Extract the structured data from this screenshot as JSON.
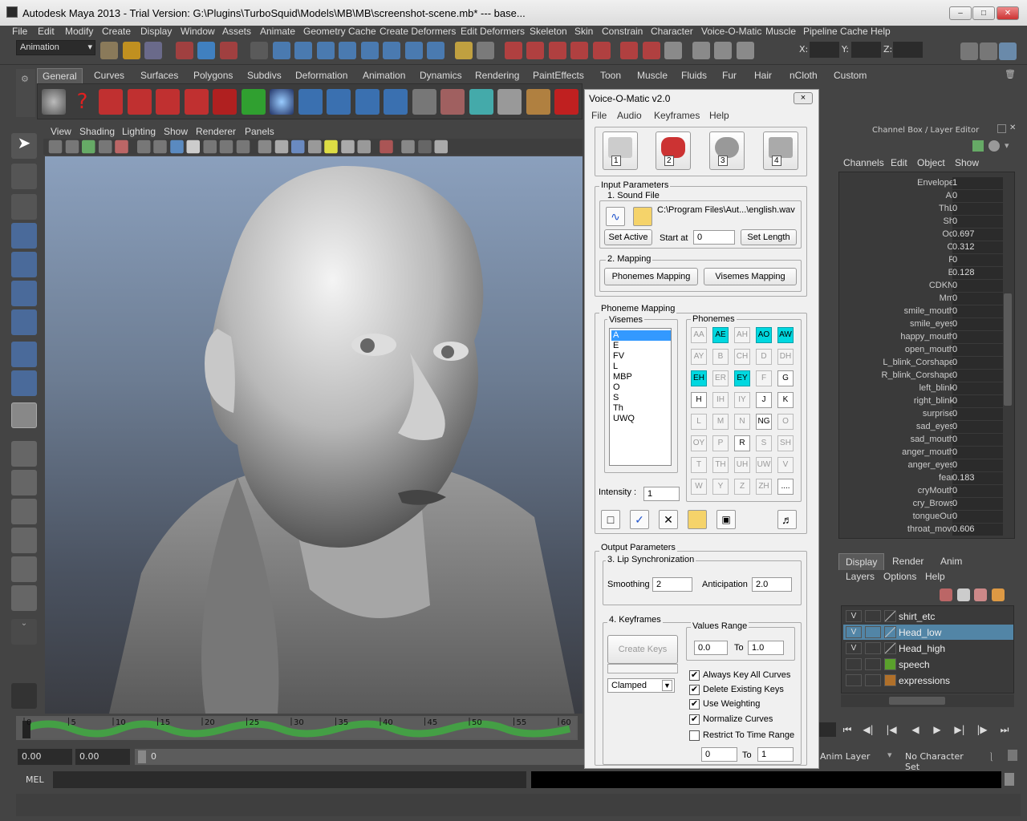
{
  "window": {
    "title": "Autodesk Maya 2013 - Trial Version: G:\\Plugins\\TurboSquid\\Models\\MB\\MB\\screenshot-scene.mb*   ---   base..."
  },
  "menubar": [
    "File",
    "Edit",
    "Modify",
    "Create",
    "Display",
    "Window",
    "Assets",
    "Animate",
    "Geometry Cache",
    "Create Deformers",
    "Edit Deformers",
    "Skeleton",
    "Skin",
    "Constrain",
    "Character",
    "Voice-O-Matic",
    "Muscle",
    "Pipeline Cache",
    "Help"
  ],
  "statusline": {
    "mode": "Animation",
    "x_label": "X:",
    "y_label": "Y:",
    "z_label": "Z:"
  },
  "shelf_tabs": [
    "General",
    "Curves",
    "Surfaces",
    "Polygons",
    "Subdivs",
    "Deformation",
    "Animation",
    "Dynamics",
    "Rendering",
    "PaintEffects",
    "Toon",
    "Muscle",
    "Fluids",
    "Fur",
    "Hair",
    "nCloth",
    "Custom"
  ],
  "viewport_menu": [
    "View",
    "Shading",
    "Lighting",
    "Show",
    "Renderer",
    "Panels"
  ],
  "channel_box": {
    "header": "Channel Box / Layer Editor",
    "menu": [
      "Channels",
      "Edit",
      "Object",
      "Show"
    ],
    "rows": [
      {
        "name": "Envelope",
        "value": "1"
      },
      {
        "name": "AI",
        "value": "0"
      },
      {
        "name": "ThL",
        "value": "0"
      },
      {
        "name": "Sh",
        "value": "0"
      },
      {
        "name": "Oo",
        "value": "0.697"
      },
      {
        "name": "O",
        "value": "0.312"
      },
      {
        "name": "F",
        "value": "0"
      },
      {
        "name": "E",
        "value": "0.128"
      },
      {
        "name": "CDKN",
        "value": "0"
      },
      {
        "name": "Mm",
        "value": "0"
      },
      {
        "name": "smile_mouth",
        "value": "0"
      },
      {
        "name": "smile_eyes",
        "value": "0"
      },
      {
        "name": "happy_mouth",
        "value": "0"
      },
      {
        "name": "open_mouth",
        "value": "0"
      },
      {
        "name": "L_blink_Corshape",
        "value": "0"
      },
      {
        "name": "R_blink_Corshape",
        "value": "0"
      },
      {
        "name": "left_blink",
        "value": "0"
      },
      {
        "name": "right_blink",
        "value": "0"
      },
      {
        "name": "surprise",
        "value": "0"
      },
      {
        "name": "sad_eyes",
        "value": "0"
      },
      {
        "name": "sad_mouth",
        "value": "0"
      },
      {
        "name": "anger_mouth",
        "value": "0"
      },
      {
        "name": "anger_eyes",
        "value": "0"
      },
      {
        "name": "fear",
        "value": "0.183"
      },
      {
        "name": "cryMouth",
        "value": "0"
      },
      {
        "name": "cry_Brows",
        "value": "0"
      },
      {
        "name": "tongueOut",
        "value": "0"
      },
      {
        "name": "throat_movt",
        "value": "0.606"
      }
    ]
  },
  "layer_editor": {
    "tabs": [
      "Display",
      "Render",
      "Anim"
    ],
    "menu": [
      "Layers",
      "Options",
      "Help"
    ],
    "layers": [
      {
        "v": "V",
        "name": "shirt_etc",
        "color": "",
        "selected": false
      },
      {
        "v": "V",
        "name": "Head_low",
        "color": "",
        "selected": true
      },
      {
        "v": "V",
        "name": "Head_high",
        "color": "",
        "selected": false
      },
      {
        "v": "",
        "name": "speech",
        "color": "#5aa02c",
        "selected": false
      },
      {
        "v": "",
        "name": "expressions",
        "color": "#b0702a",
        "selected": false
      }
    ]
  },
  "timeline": {
    "ticks": [
      "0",
      "5",
      "10",
      "15",
      "20",
      "25",
      "30",
      "35",
      "40",
      "45",
      "50",
      "55",
      "60"
    ]
  },
  "range": {
    "start": "0.00",
    "start2": "0.00",
    "current": "0"
  },
  "bottom": {
    "anim_layer": "Anim Layer",
    "character_set": "No Character Set",
    "mel": "MEL"
  },
  "vom": {
    "title": "Voice-O-Matic v2.0",
    "close": "×",
    "menu": [
      "File",
      "Audio",
      "Keyframes",
      "Help"
    ],
    "step_nums": [
      "1",
      "2",
      "3",
      "4"
    ],
    "input_params": "Input Parameters",
    "sound_file_label": "1. Sound File",
    "sound_file_path": "C:\\Program Files\\Aut...\\english.wav",
    "set_active": "Set Active",
    "start_at_label": "Start at",
    "start_at_value": "0",
    "set_length": "Set Length",
    "mapping_label": "2. Mapping",
    "phonemes_mapping": "Phonemes Mapping",
    "visemes_mapping": "Visemes Mapping",
    "phoneme_mapping_label": "Phoneme Mapping",
    "visemes_label": "Visemes",
    "phonemes_label": "Phonemes",
    "visemes": [
      "A",
      "E",
      "FV",
      "L",
      "MBP",
      "O",
      "S",
      "Th",
      "UWQ"
    ],
    "phonemes": [
      [
        {
          "t": "AA",
          "s": "off"
        },
        {
          "t": "AE",
          "s": "on"
        },
        {
          "t": "AH",
          "s": "off"
        },
        {
          "t": "AO",
          "s": "on"
        },
        {
          "t": "AW",
          "s": "on"
        }
      ],
      [
        {
          "t": "AY",
          "s": "off"
        },
        {
          "t": "B",
          "s": "off"
        },
        {
          "t": "CH",
          "s": "off"
        },
        {
          "t": "D",
          "s": "off"
        },
        {
          "t": "DH",
          "s": "off"
        }
      ],
      [
        {
          "t": "EH",
          "s": "on"
        },
        {
          "t": "ER",
          "s": "off"
        },
        {
          "t": "EY",
          "s": "on"
        },
        {
          "t": "F",
          "s": "off"
        },
        {
          "t": "G",
          "s": "en"
        }
      ],
      [
        {
          "t": "H",
          "s": "en"
        },
        {
          "t": "IH",
          "s": "off"
        },
        {
          "t": "IY",
          "s": "off"
        },
        {
          "t": "J",
          "s": "en"
        },
        {
          "t": "K",
          "s": "en"
        }
      ],
      [
        {
          "t": "L",
          "s": "off"
        },
        {
          "t": "M",
          "s": "off"
        },
        {
          "t": "N",
          "s": "off"
        },
        {
          "t": "NG",
          "s": "en"
        },
        {
          "t": "O",
          "s": "off"
        }
      ],
      [
        {
          "t": "OY",
          "s": "off"
        },
        {
          "t": "P",
          "s": "off"
        },
        {
          "t": "R",
          "s": "en"
        },
        {
          "t": "S",
          "s": "off"
        },
        {
          "t": "SH",
          "s": "off"
        }
      ],
      [
        {
          "t": "T",
          "s": "off"
        },
        {
          "t": "TH",
          "s": "off"
        },
        {
          "t": "UH",
          "s": "off"
        },
        {
          "t": "UW",
          "s": "off"
        },
        {
          "t": "V",
          "s": "off"
        }
      ],
      [
        {
          "t": "W",
          "s": "off"
        },
        {
          "t": "Y",
          "s": "off"
        },
        {
          "t": "Z",
          "s": "off"
        },
        {
          "t": "ZH",
          "s": "off"
        },
        {
          "t": "....",
          "s": "en"
        }
      ]
    ],
    "intensity_label": "Intensity :",
    "intensity_value": "1",
    "output_params": "Output Parameters",
    "lip_sync_label": "3. Lip Synchronization",
    "smoothing_label": "Smoothing",
    "smoothing_value": "2",
    "anticipation_label": "Anticipation",
    "anticipation_value": "2.0",
    "keyframes_label": "4. Keyframes",
    "create_keys": "Create Keys",
    "values_range_label": "Values Range",
    "values_from": "0.0",
    "to_label": "To",
    "values_to": "1.0",
    "tangent": "Clamped",
    "checks": [
      {
        "label": "Always Key All Curves",
        "checked": true
      },
      {
        "label": "Delete Existing Keys",
        "checked": true
      },
      {
        "label": "Use Weighting",
        "checked": true
      },
      {
        "label": "Normalize Curves",
        "checked": true
      },
      {
        "label": "Restrict To Time Range",
        "checked": false
      }
    ],
    "time_from": "0",
    "time_to": "1"
  }
}
